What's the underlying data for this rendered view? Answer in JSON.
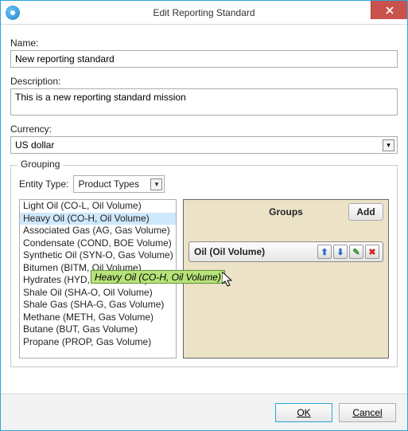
{
  "window": {
    "title": "Edit Reporting Standard"
  },
  "labels": {
    "name": "Name:",
    "description": "Description:",
    "currency": "Currency:",
    "grouping": "Grouping",
    "entity_type": "Entity Type:",
    "groups_header": "Groups"
  },
  "fields": {
    "name": "New reporting standard",
    "description": "This is a new reporting standard mission",
    "currency": "US dollar",
    "entity_type": "Product Types"
  },
  "product_types": [
    "Light Oil (CO-L, Oil Volume)",
    "Heavy Oil (CO-H, Oil Volume)",
    "Associated Gas (AG, Gas Volume)",
    "Condensate (COND, BOE Volume)",
    "Synthetic Oil (SYN-O, Gas Volume)",
    "Bitumen (BITM, Oil Volume)",
    "Hydrates (HYD, Gas Volume)",
    "Shale Oil (SHA-O, Oil Volume)",
    "Shale Gas (SHA-G, Gas Volume)",
    "Methane (METH, Gas Volume)",
    "Butane (BUT, Gas Volume)",
    "Propane (PROP, Gas Volume)"
  ],
  "selected_index": 1,
  "drag_tooltip": "Heavy Oil (CO-H, Oil Volume)",
  "group_row": {
    "label": "Oil (Oil Volume)"
  },
  "buttons": {
    "add": "Add",
    "ok": "OK",
    "cancel": "Cancel"
  }
}
